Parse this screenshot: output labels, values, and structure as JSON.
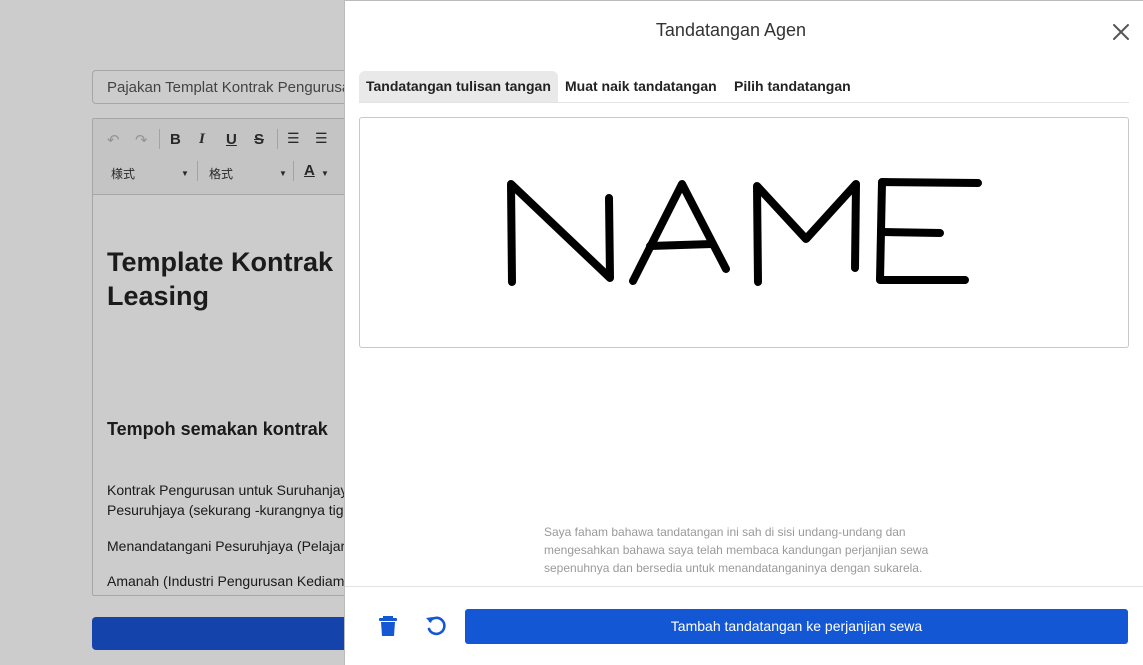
{
  "background": {
    "title_input_value": "Pajakan Templat Kontrak Pengurusan",
    "toolbar": {
      "style_select": "様式",
      "format_select": "格式"
    },
    "document": {
      "heading_line1": "Template Kontrak",
      "heading_line2": "Leasing",
      "subheading": "Tempoh semakan kontrak",
      "paragraph1_line1": "Kontrak Pengurusan untuk Suruhanjaya",
      "paragraph1_line2": "Pesuruhjaya (sekurang -kurangnya tiga",
      "paragraph2": "Menandatangani Pesuruhjaya (Pelajaran",
      "paragraph3": "Amanah (Industri Pengurusan Kediaman"
    }
  },
  "modal": {
    "title": "Tandatangan Agen",
    "tabs": [
      {
        "label": "Tandatangan tulisan tangan",
        "active": true
      },
      {
        "label": "Muat naik tandatangan",
        "active": false
      },
      {
        "label": "Pilih tandatangan",
        "active": false
      }
    ],
    "signature_text": "NAME",
    "disclaimer_line1": "Saya faham bahawa tandatangan ini sah di sisi undang-undang dan",
    "disclaimer_line2": "mengesahkan bahawa saya telah membaca kandungan perjanjian sewa",
    "disclaimer_line3": "sepenuhnya dan bersedia untuk menandatanganinya dengan sukarela.",
    "primary_button": "Tambah tandatangan ke perjanjian sewa",
    "icons": {
      "close": "close-icon",
      "delete": "trash-icon",
      "reset": "undo-icon"
    },
    "colors": {
      "primary": "#1457d4",
      "icon": "#1457d4"
    }
  }
}
